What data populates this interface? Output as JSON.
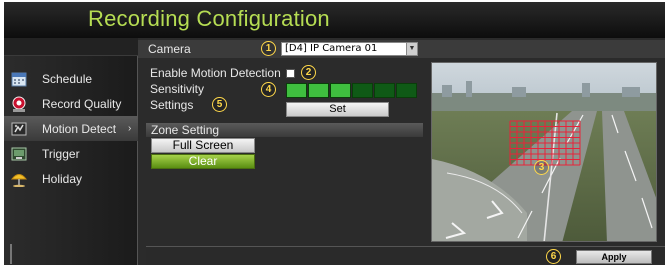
{
  "window": {
    "title": "Recording Configuration"
  },
  "sidebar": {
    "items": [
      {
        "label": "Schedule",
        "icon": "calendar-icon"
      },
      {
        "label": "Record Quality",
        "icon": "record-quality-icon"
      },
      {
        "label": "Motion Detect",
        "icon": "motion-detect-icon",
        "active": true,
        "arrow": "›"
      },
      {
        "label": "Trigger",
        "icon": "trigger-icon"
      },
      {
        "label": "Holiday",
        "icon": "holiday-umbrella-icon"
      }
    ]
  },
  "camera": {
    "label": "Camera",
    "selected": "[D4] IP Camera 01"
  },
  "motion": {
    "enable_label": "Enable Motion Detection",
    "enabled": false,
    "sensitivity_label": "Sensitivity",
    "sensitivity_level": 3,
    "sensitivity_max": 6,
    "settings_label": "Settings",
    "set_label": "Set"
  },
  "zone": {
    "title": "Zone Setting",
    "full_screen_label": "Full Screen",
    "clear_label": "Clear"
  },
  "apply_label": "Apply",
  "markers": [
    "1",
    "2",
    "3",
    "4",
    "5",
    "6"
  ],
  "colors": {
    "title_green": "#b6dd53",
    "sensitivity_on": "#3fbf3f",
    "sensitivity_off": "#0f5a16",
    "motion_grid": "#e8233a",
    "marker_yellow": "#ffd84a"
  }
}
